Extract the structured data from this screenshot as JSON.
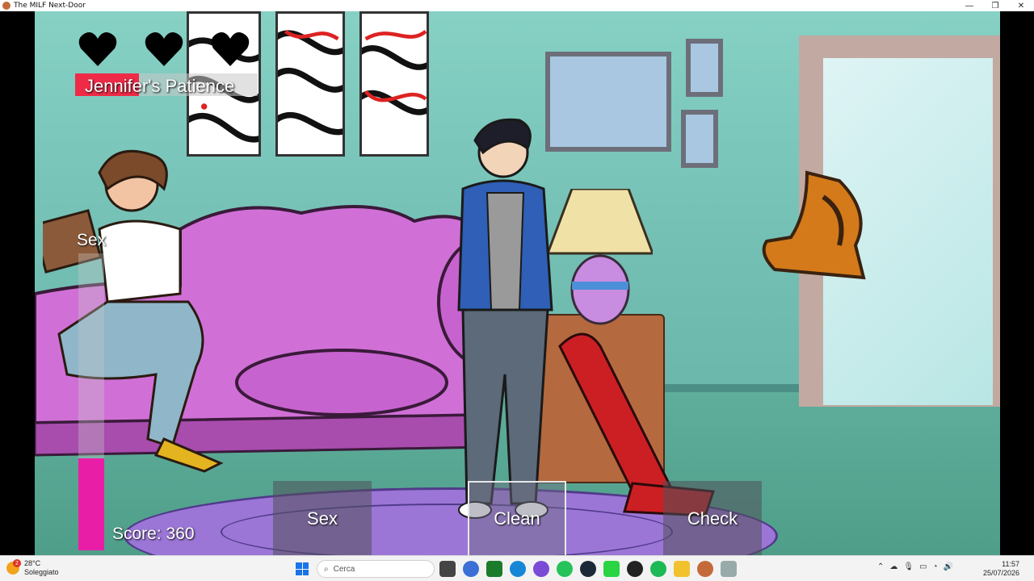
{
  "window": {
    "title": "The MILF Next-Door",
    "minimize": "—",
    "maximize": "❐",
    "close": "✕"
  },
  "hud": {
    "hearts": 3,
    "patience_label": "Jennifer's Patience",
    "patience_level": 0.35,
    "sex_meter_label": "Sex",
    "sex_meter_level": 0.31,
    "score_text": "Score: 360"
  },
  "actions": [
    {
      "label": "Sex",
      "selected": false
    },
    {
      "label": "Clean",
      "selected": true
    },
    {
      "label": "Check",
      "selected": false
    }
  ],
  "colors": {
    "patience_fill": "#ee2a47",
    "sex_meter_fill": "#e91ea6",
    "sofa": "#d070d6",
    "heart": "#000000"
  },
  "taskbar": {
    "weather_badge": "2",
    "weather_temp": "28°C",
    "weather_desc": "Soleggiato",
    "search_placeholder": "Cerca",
    "time": "11:57",
    "date": "25/07/2026"
  }
}
